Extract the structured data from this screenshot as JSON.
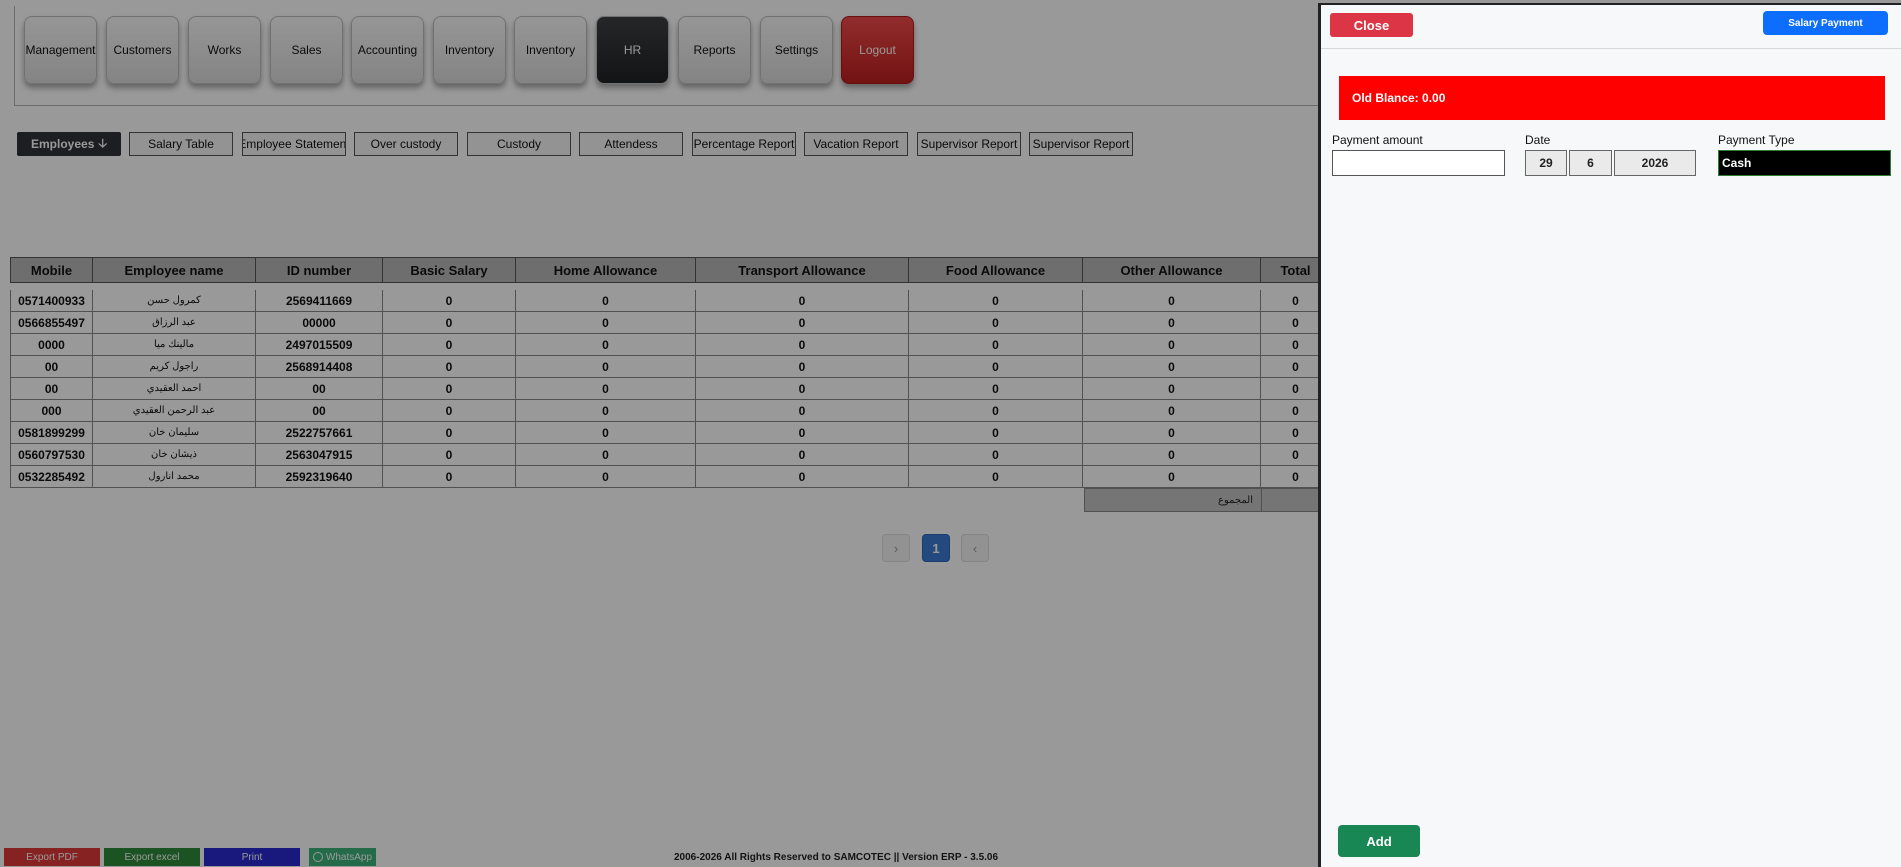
{
  "nav": {
    "items": [
      {
        "label": "Management"
      },
      {
        "label": "Customers"
      },
      {
        "label": "Works"
      },
      {
        "label": "Sales"
      },
      {
        "label": "Accounting"
      },
      {
        "label": "Inventory"
      },
      {
        "label": "Inventory"
      },
      {
        "label": "HR",
        "active": true
      },
      {
        "label": "Reports"
      },
      {
        "label": "Settings"
      },
      {
        "label": "Logout"
      }
    ]
  },
  "subnav": {
    "items": [
      {
        "label": "Employees",
        "active": true
      },
      {
        "label": "Salary Table"
      },
      {
        "label": "Employee Statement"
      },
      {
        "label": "Over custody"
      },
      {
        "label": "Custody"
      },
      {
        "label": "Attendess"
      },
      {
        "label": "Percentage Report"
      },
      {
        "label": "Vacation Report"
      },
      {
        "label": "Supervisor Report"
      },
      {
        "label": "Supervisor Report"
      }
    ],
    "active_icon": "arrow-down-icon"
  },
  "table": {
    "columns": [
      "Mobile",
      "Employee name",
      "ID number",
      "Basic Salary",
      "Home Allowance",
      "Transport Allowance",
      "Food Allowance",
      "Other Allowance",
      "Total"
    ],
    "rows": [
      [
        "0571400933",
        "كمرول حسن",
        "2569411669",
        "0",
        "0",
        "0",
        "0",
        "0",
        "0"
      ],
      [
        "0566855497",
        "عبد الرزاق",
        "00000",
        "0",
        "0",
        "0",
        "0",
        "0",
        "0"
      ],
      [
        "0000",
        "مالينك ميا",
        "2497015509",
        "0",
        "0",
        "0",
        "0",
        "0",
        "0"
      ],
      [
        "00",
        "راجول كريم",
        "2568914408",
        "0",
        "0",
        "0",
        "0",
        "0",
        "0"
      ],
      [
        "00",
        "احمد العقيدي",
        "00",
        "0",
        "0",
        "0",
        "0",
        "0",
        "0"
      ],
      [
        "000",
        "عبد الرحمن العقيدي",
        "00",
        "0",
        "0",
        "0",
        "0",
        "0",
        "0"
      ],
      [
        "0581899299",
        "سليمان خان",
        "2522757661",
        "0",
        "0",
        "0",
        "0",
        "0",
        "0"
      ],
      [
        "0560797530",
        "ذيشان خان",
        "2563047915",
        "0",
        "0",
        "0",
        "0",
        "0",
        "0"
      ],
      [
        "0532285492",
        "محمد انارول",
        "2592319640",
        "0",
        "0",
        "0",
        "0",
        "0",
        "0"
      ]
    ],
    "total_label": "المجموع"
  },
  "pager": {
    "prev": "›",
    "current": "1",
    "next": "‹"
  },
  "footer": {
    "export_pdf": "Export PDF",
    "export_excel": "Export excel",
    "print": "Print",
    "whatsapp": "WhatsApp",
    "copyright": "2006-2026 All Rights Reserved to  SAMCOTEC || Version ERP - 3.5.06"
  },
  "panel": {
    "close_label": "Close",
    "title": "Salary Payment",
    "old_balance": "Old Blance: 0.00",
    "payment_amount_label": "Payment amount",
    "payment_amount_value": "",
    "date_label": "Date",
    "date_day": "29",
    "date_month": "6",
    "date_year": "2026",
    "payment_type_label": "Payment Type",
    "payment_type_value": "Cash",
    "add_label": "Add"
  },
  "colors": {
    "close": "#dc3545",
    "title": "#0d6efd",
    "balance": "#ff0000",
    "add": "#198754",
    "nav_active": "#2a2d30",
    "logout": "#d62b2b"
  }
}
